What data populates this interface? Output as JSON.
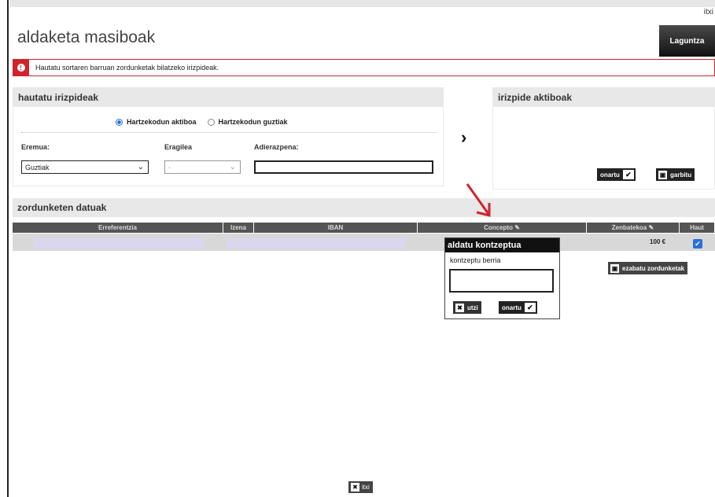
{
  "header": {
    "top_link": "itxi",
    "title": "aldaketa masiboak",
    "help_label": "Laguntza"
  },
  "alert": {
    "text": "Hautatu sortaren barruan zordunketak bilatzeko irizpideak."
  },
  "criteria": {
    "title": "hautatu irizpideak",
    "radio_active": "Hartzekodun aktiboa",
    "radio_all": "Hartzekodun guztiak",
    "eremua_label": "Eremua:",
    "eremua_value": "Guztiak",
    "eragilea_label": "Eragilea",
    "eragilea_value": "-",
    "adierazpena_label": "Adierazpena:"
  },
  "active": {
    "title": "irizpide aktiboak",
    "confirm_label": "onartu",
    "clear_label": "garbitu"
  },
  "data_section": {
    "title": "zordunketen datuak",
    "columns": [
      "Erreferentzia",
      "Izena",
      "IBAN",
      "Concepto",
      "Zenbatekoa",
      "Haut"
    ],
    "row_amount": "100 €",
    "delete_label": "ezabatu zordunketak"
  },
  "popup": {
    "title": "aldatu kontzeptua",
    "label": "kontzeptu berria",
    "cancel_label": "utzi",
    "confirm_label": "onartu"
  },
  "footer": {
    "close_label": "itxi"
  },
  "colors": {
    "accent_red": "#d0232b",
    "checkbox_blue": "#2a6fd6",
    "header_gray": "#555555"
  }
}
